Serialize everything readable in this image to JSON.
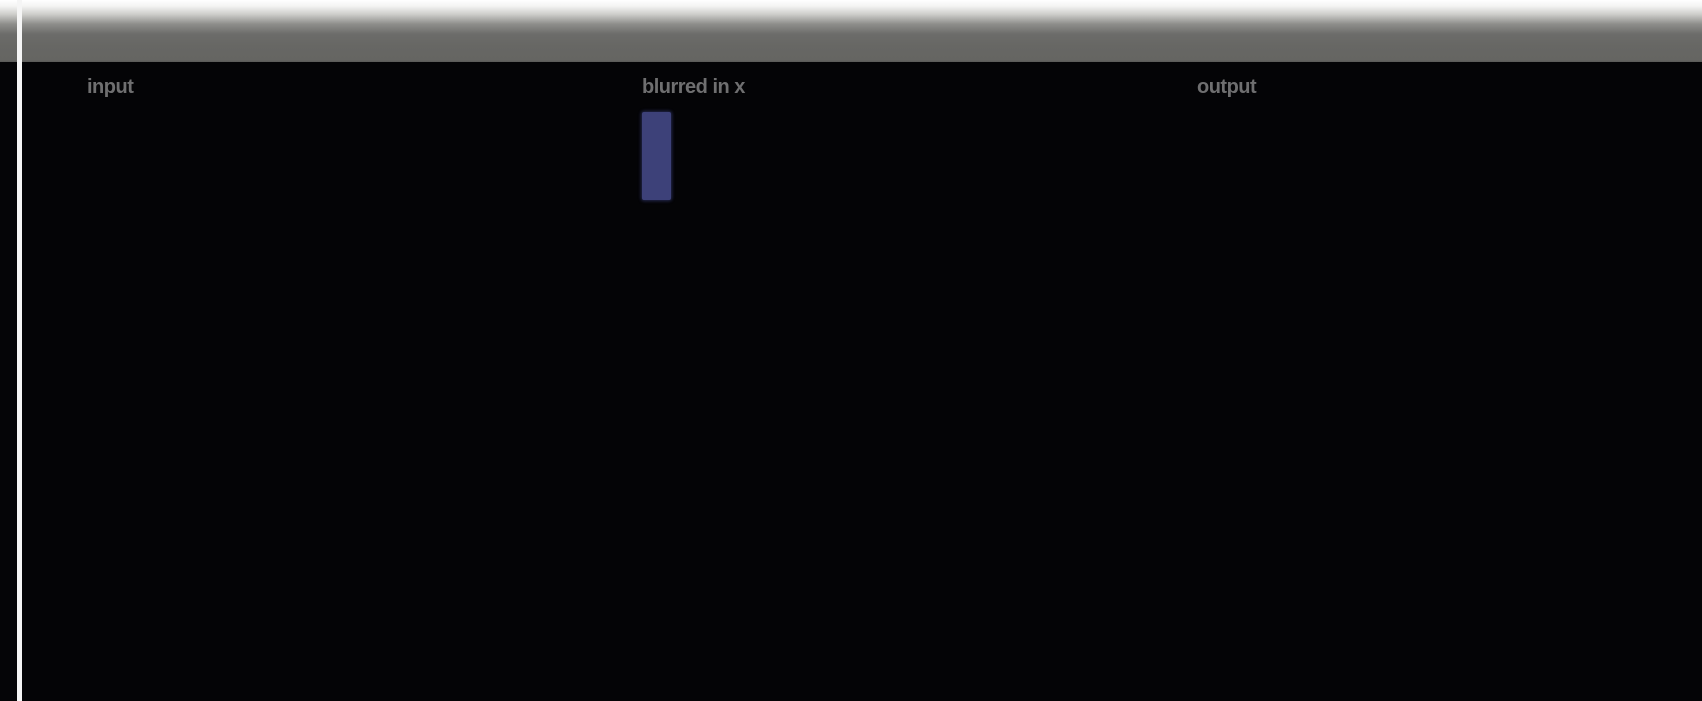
{
  "panels": [
    {
      "label": "input"
    },
    {
      "label": "blurred in x"
    },
    {
      "label": "output"
    }
  ],
  "colors": {
    "background": "#040406",
    "label": "#6f6f70",
    "blur_strip": "#3d4179",
    "top_bar": "#676764"
  }
}
